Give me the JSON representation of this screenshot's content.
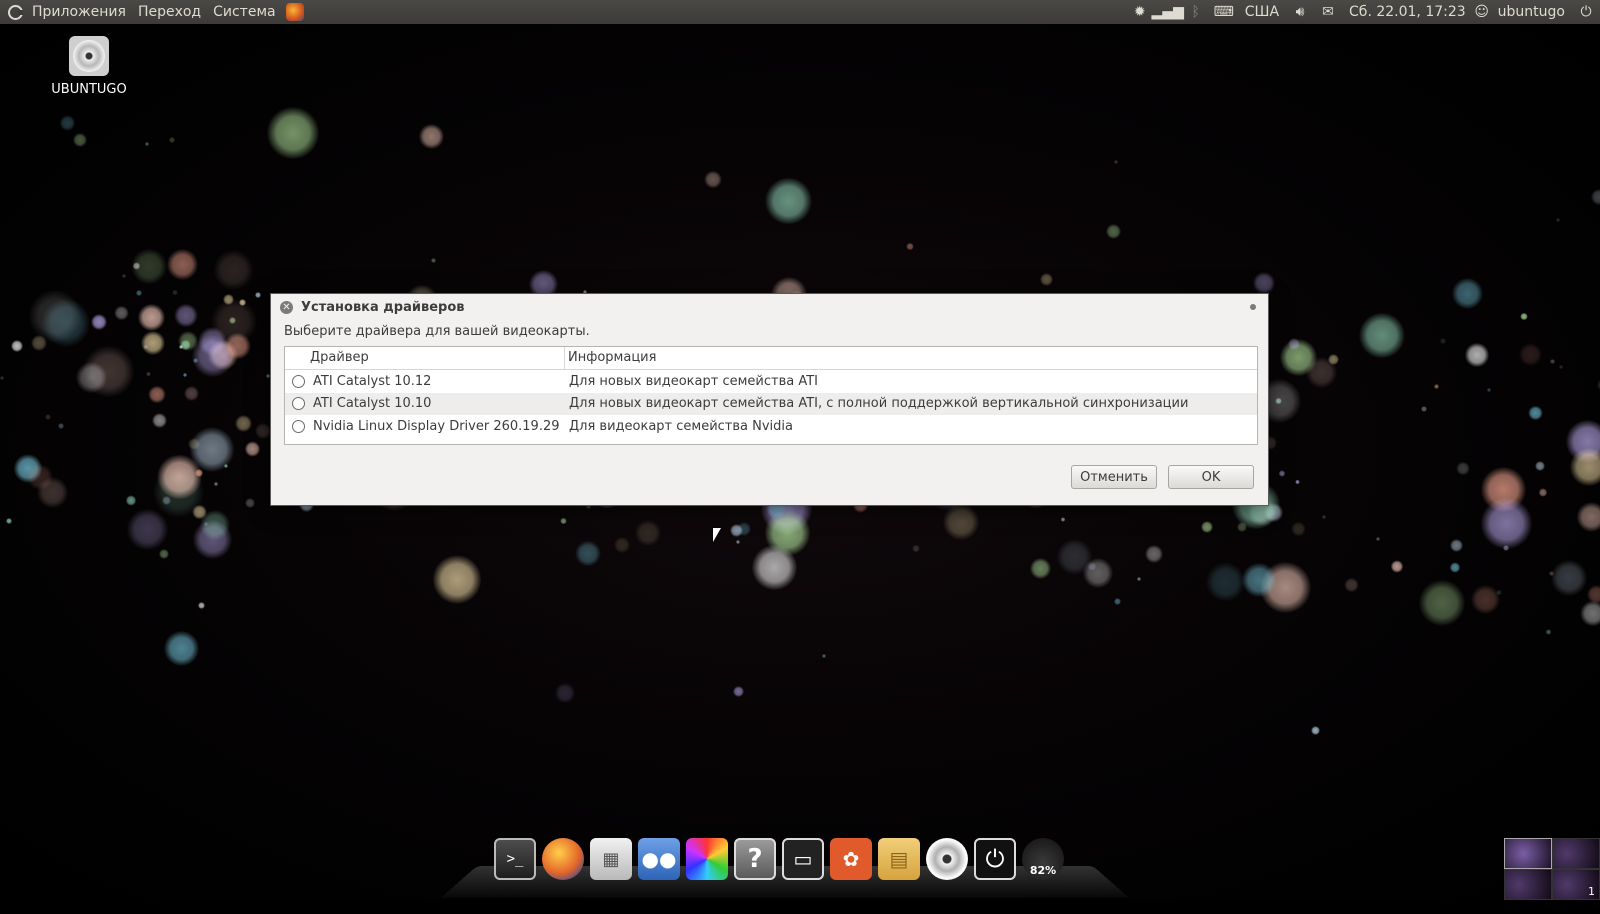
{
  "top_panel": {
    "menu": [
      "Приложения",
      "Переход",
      "Система"
    ],
    "tray": {
      "keyboard_layout": "США",
      "clock": "Сб. 22.01, 17:23",
      "user": "ubuntugo",
      "icons": [
        "settings-icon",
        "network-signal-icon",
        "bluetooth-icon",
        "keyboard-icon",
        "volume-icon",
        "mail-icon",
        "user-icon",
        "power-icon"
      ]
    }
  },
  "desktop": {
    "icon_label": "UBUNTUGO"
  },
  "dialog": {
    "title": "Установка драйверов",
    "prompt": "Выберите драйвера для вашей видеокарты.",
    "table": {
      "columns": [
        "Драйвер",
        "Информация"
      ],
      "rows": [
        {
          "driver": "ATI Catalyst 10.12",
          "info": "Для новых видеокарт семейства ATI"
        },
        {
          "driver": "ATI Catalyst 10.10",
          "info": "Для новых видеокарт семейства ATI, с полной поддержкой вертикальной синхронизации"
        },
        {
          "driver": "Nvidia Linux Display Driver 260.19.29",
          "info": "Для видеокарт семейства Nvidia"
        }
      ]
    },
    "buttons": {
      "cancel": "Отменить",
      "ok": "OK"
    }
  },
  "dock": {
    "items": [
      "terminal-icon",
      "firefox-icon",
      "calculator-icon",
      "chat-icon",
      "color-picker-icon",
      "help-icon",
      "show-desktop-icon",
      "ubuntu-software-icon",
      "folder-icon",
      "dvd-icon",
      "power-icon",
      "system-monitor-icon"
    ],
    "terminal_glyph": ">_",
    "help_glyph": "?",
    "monitor_value": "82%"
  },
  "workspaces": {
    "active_label": "1"
  }
}
